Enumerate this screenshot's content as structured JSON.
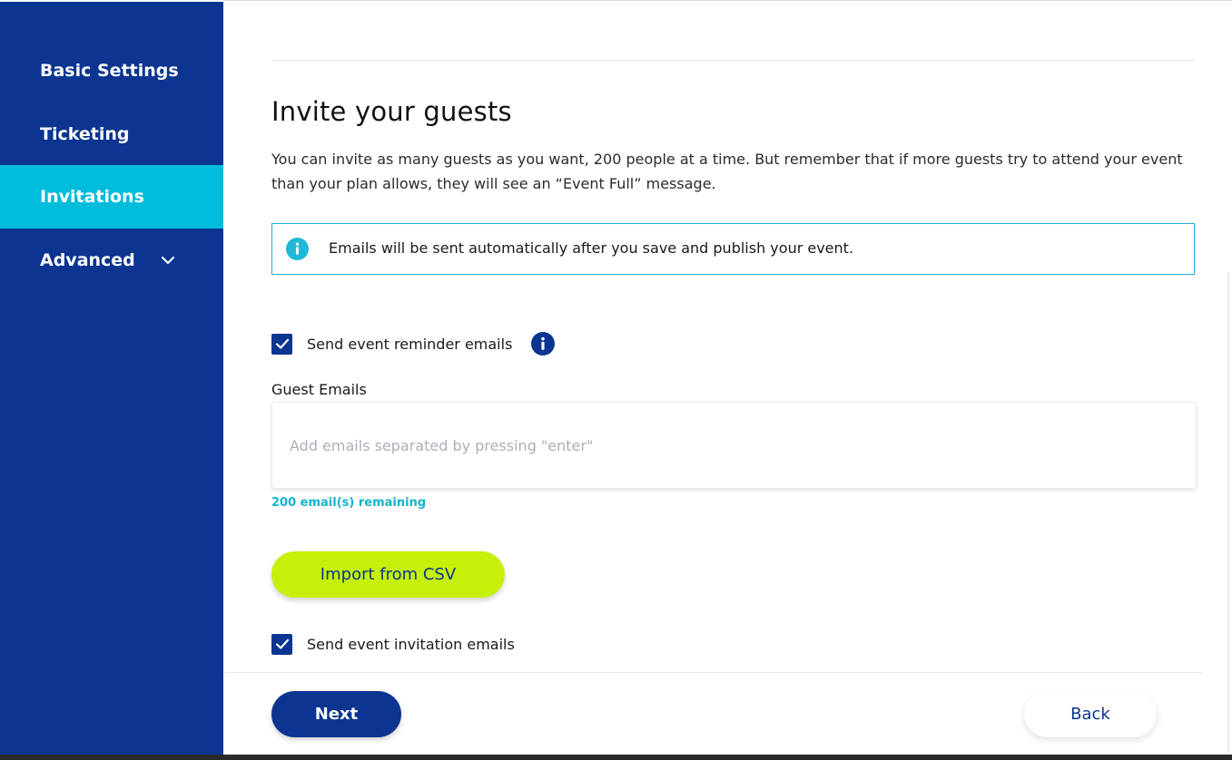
{
  "sidebar": {
    "items": [
      {
        "label": "Basic Settings"
      },
      {
        "label": "Ticketing"
      },
      {
        "label": "Invitations",
        "active": true
      },
      {
        "label": "Advanced",
        "icon": "chevron-down-icon"
      }
    ]
  },
  "main": {
    "title": "Invite your guests",
    "description": "You can invite as many guests as you want, 200 people at a time. But remember that if more guests try to attend your event than your plan allows, they will see an “Event Full” message.",
    "info_notice": "Emails will be sent automatically after you save and publish your event.",
    "reminder_checkbox": {
      "label": "Send event reminder emails",
      "checked": true
    },
    "guest_emails": {
      "label": "Guest Emails",
      "placeholder": "Add emails separated by pressing \"enter\"",
      "value": "",
      "remaining": "200 email(s) remaining"
    },
    "import_button": "Import from CSV",
    "invitation_checkbox": {
      "label": "Send event invitation emails",
      "checked": true
    }
  },
  "footer": {
    "next_label": "Next",
    "back_label": "Back"
  },
  "colors": {
    "sidebar_bg": "#0b3590",
    "sidebar_active": "#00bcdc",
    "accent_lime": "#c6f00a",
    "info_border": "#1fb2cf",
    "remaining_text": "#15b3d0"
  }
}
